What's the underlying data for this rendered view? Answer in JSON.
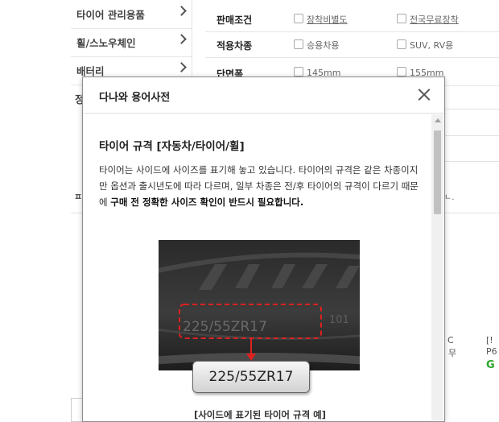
{
  "sidebar": {
    "categories": [
      {
        "label": "타이어 관리용품"
      },
      {
        "label": "휠/스노우체인"
      },
      {
        "label": "배터리"
      }
    ],
    "cut_off_item": "정"
  },
  "filters": {
    "sale_condition": {
      "label": "판매조건",
      "options": [
        "장착비별도",
        "전국무료장착"
      ]
    },
    "vehicle_type": {
      "label": "적용차종",
      "options": [
        "승용차용",
        "SUV, RV용"
      ]
    },
    "section_width": {
      "label": "단면폭",
      "options": [
        "145mm",
        "155mm"
      ]
    }
  },
  "background_fragments": {
    "dot_right": "ㄴ.",
    "left_char": "ㅍ",
    "col_c": "C",
    "col_mu": "무",
    "col_bracket": "[!",
    "col_p6": "P6",
    "col_g": "G"
  },
  "modal": {
    "title": "다나와 용어사전",
    "term_title": "타이어 규격 [자동차/타이어/휠]",
    "description_normal": "타이어는 사이드에 사이즈를 표기해 놓고 있습니다. 타이어의 규격은 같은 차종이지만 옵션과 출시년도에 따라 다르며, 일부 차종은 전/후 타이어의 규격이 다르기 때문에 ",
    "description_bold": "구매 전 정확한 사이즈 확인이 반드시 필요합니다.",
    "image": {
      "sidewall_text": "225/55ZR17",
      "sidewall_suffix": "101",
      "badge_text": "225/55ZR17"
    },
    "caption": "[사이드에 표기된 타이어 규격 예]"
  },
  "colors": {
    "highlight_dash": "#e02020",
    "badge_bg": "#e6e6e6",
    "text": "#333333"
  }
}
